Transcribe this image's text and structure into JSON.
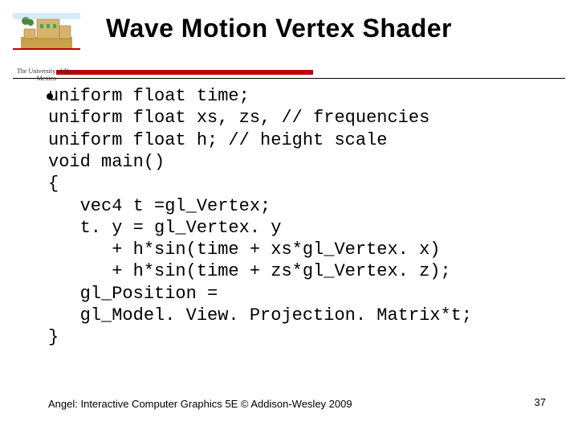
{
  "header": {
    "title": "Wave Motion Vertex Shader",
    "university": "The University of New Mexico",
    "logo": {
      "name": "unm-logo",
      "accent": "#c00000",
      "sand": "#c9a14a",
      "sky": "#6ec0e8",
      "tan": "#d7b36b"
    }
  },
  "rules": {
    "thick_color": "#c00000",
    "thin_color": "#000000"
  },
  "code": {
    "lines": [
      "uniform float time;",
      "uniform float xs, zs, // frequencies",
      "uniform float h; // height scale",
      "void main()",
      "{",
      "   vec4 t =gl_Vertex;",
      "   t. y = gl_Vertex. y",
      "      + h*sin(time + xs*gl_Vertex. x)",
      "      + h*sin(time + zs*gl_Vertex. z);",
      "   gl_Position =",
      "   gl_Model. View. Projection. Matrix*t;",
      "}"
    ]
  },
  "footer": {
    "citation": "Angel: Interactive Computer Graphics 5E © Addison-Wesley 2009",
    "page_number": "37"
  }
}
